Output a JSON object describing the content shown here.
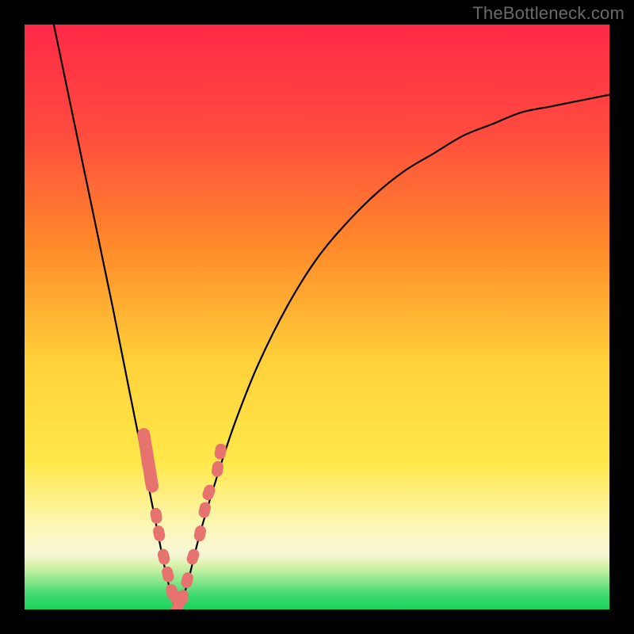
{
  "watermark": "TheBottleneck.com",
  "colors": {
    "red": "#ff2a47",
    "orange": "#ff8a2a",
    "yellow": "#ffe84b",
    "pale": "#fcf9c8",
    "green_light": "#7fe87f",
    "green": "#18d45b",
    "curve": "#000000",
    "marker": "#e6736e",
    "frame": "#000000"
  },
  "chart_data": {
    "type": "line",
    "title": "",
    "xlabel": "",
    "ylabel": "",
    "xlim": [
      0,
      100
    ],
    "ylim": [
      0,
      100
    ],
    "note": "V-shaped bottleneck curve; y≈0 is ideal (green), y≈100 is worst (red). Minimum at value/x≈26.",
    "series": [
      {
        "name": "bottleneck-curve",
        "x": [
          5,
          10,
          15,
          18,
          20,
          22,
          24,
          25,
          26,
          27,
          28,
          30,
          33,
          36,
          40,
          45,
          50,
          55,
          60,
          65,
          70,
          75,
          80,
          85,
          90,
          95,
          100
        ],
        "y": [
          100,
          76,
          52,
          37,
          27,
          17,
          7,
          3,
          0,
          2,
          5,
          13,
          23,
          32,
          42,
          52,
          60,
          66,
          71,
          75,
          78,
          81,
          83,
          85,
          86,
          87,
          88
        ]
      }
    ],
    "markers": {
      "name": "highlighted-points",
      "x": [
        21.0,
        21.5,
        22.5,
        23.0,
        23.8,
        24.5,
        25.2,
        26.0,
        27.0,
        27.8,
        28.8,
        30.0,
        30.8,
        31.5,
        33.0,
        33.5
      ],
      "y": [
        25,
        22,
        16,
        13,
        9,
        6,
        3,
        0,
        2,
        5,
        9,
        13,
        17,
        20,
        24,
        27
      ]
    }
  }
}
